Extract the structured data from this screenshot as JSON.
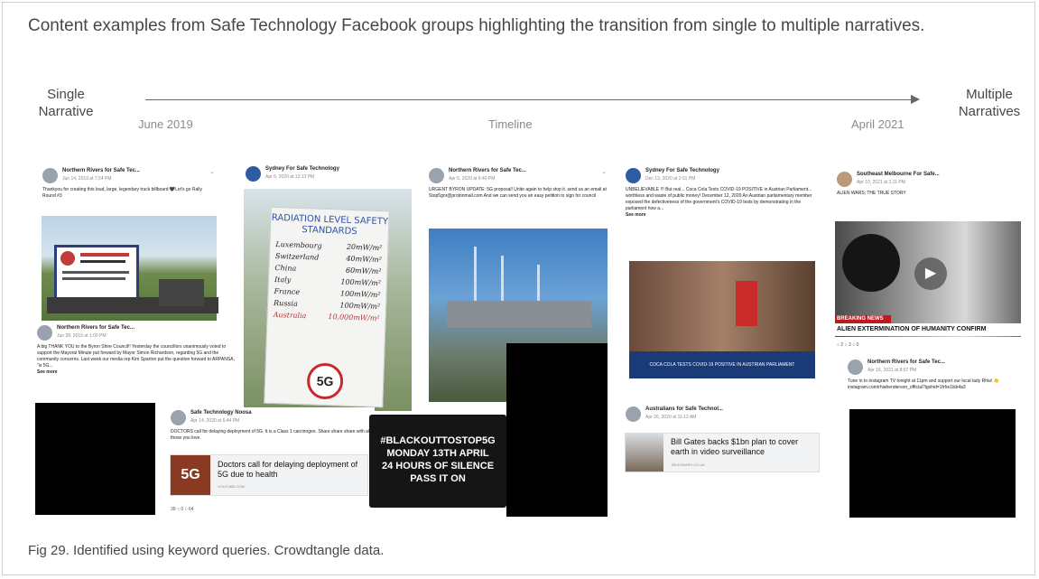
{
  "title": "Content examples from Safe Technology Facebook groups highlighting the transition from single to multiple narratives.",
  "timeline": {
    "left_label": "Single\nNarrative",
    "right_label": "Multiple\nNarratives",
    "start": "June 2019",
    "middle": "Timeline",
    "end": "April 2021"
  },
  "posts": {
    "p1": {
      "group": "Northern Rivers for Safe Tec...",
      "date": "Jun 14, 2019 at 7:24 PM",
      "text": "Thankyou for creating this loud, large, legendary truck billboard 🖤Let's go Rally Round #3"
    },
    "p2": {
      "group": "Northern Rivers for Safe Tec...",
      "date": "Jun 28, 2019 at 1:00 PM",
      "text": "A big THANK YOU to the Byron Shire Council!! Yesterday the councillors unanimously voted to support the Mayoral Minute put forward by Mayor Simon Richardson, regarding 5G and the community concerns. Last week our media rep Kim Sparton put the question forward to ARPANSA, \"is 5G...",
      "more": "See more"
    },
    "p3": {
      "group": "Sydney For Safe Technology",
      "date": "Apr 5, 2020 at 12:13 PM",
      "sign_title": "RADIATION LEVEL SAFETY STANDARDS",
      "rows": [
        [
          "Luxembourg",
          "20mW/m²"
        ],
        [
          "Switzerland",
          "40mW/m²"
        ],
        [
          "China",
          "60mW/m²"
        ],
        [
          "Italy",
          "100mW/m²"
        ],
        [
          "France",
          "100mW/m²"
        ],
        [
          "Russia",
          "100mW/m²"
        ],
        [
          "Australia",
          "10,000mW/m²"
        ]
      ],
      "badge": "5G"
    },
    "p4": {
      "group": "Safe Technology Noosa",
      "date": "Apr 14, 2020 at 6:44 PM",
      "text": "DOCTORS call for delaying deployment of 5G. It is a Class 1 carcinogen. Share share share with all those you love.",
      "link_title": "Doctors call for delaying deployment of 5G due to health",
      "link_source": "YOUTUBE.COM",
      "reactions": "39   ○ 0   ○ 64"
    },
    "p5": {
      "group": "Northern Rivers for Safe Tec...",
      "date": "Apr 5, 2020 at 6:40 PM",
      "text": "URGENT BYRON UPDATE: 5G proposal! Unite again to help stop it. send us an email at Stop5gnr@protonmail.com And we can send you an easy petition to sign for council"
    },
    "p6": {
      "banner": "#BLACKOUTTOSTOP5G\nMONDAY 13TH APRIL\n24 HOURS OF SILENCE\nPASS IT ON"
    },
    "p7": {
      "group": "Sydney For Safe Technology",
      "date": "Dec 13, 2020 at 2:01 PM",
      "text": "UNBELIEVABLE !!! But real... Coca Cola Tests COVID-19 POSITIVE in Austrian Parliament... worthless and waste of public money! December 12, 2020 An Austrian parliamentary member exposed the defectiveness of the government's COVID-19 tests by demonstrating in the parliament how a...",
      "more": "See more",
      "video_caption": "COCA COLA TESTS COVID-19 POSITIVE IN AUSTRIAN PARLIAMENT"
    },
    "p8": {
      "group": "Australians for Safe Technol...",
      "date": "Apr 26, 2020 at 11:12 AM",
      "link_title": "Bill Gates backs $1bn plan to cover earth in video surveillance",
      "link_source": "TELEGRAPH.CO.UK"
    },
    "p9": {
      "group": "Southeast Melbourne For Safe...",
      "date": "Apr 10, 2021 at 1:11 PM",
      "text": "ALIEN WARS; THE TRUE STORY",
      "breaking": "BREAKING NEWS",
      "headline": "ALIEN EXTERMINATION OF HUMANITY CONFIRM",
      "reactions": "○ 2   ○ 3   ○ 0"
    },
    "p10": {
      "group": "Northern Rivers for Safe Tec...",
      "date": "Apr 16, 2021 at 8:57 PM",
      "text": "Tune in to instagram TV tonight at 11pm and support our local lady Rhia! 👏 instagram.com/rhiahenderson_official?igshid=1frhe1lsb4a3"
    }
  },
  "caption": "Fig 29. Identified using keyword queries. Crowdtangle data.",
  "colors": {
    "text": "#474747",
    "line": "#666666",
    "sign_red": "#b5343a",
    "black": "#000000"
  }
}
